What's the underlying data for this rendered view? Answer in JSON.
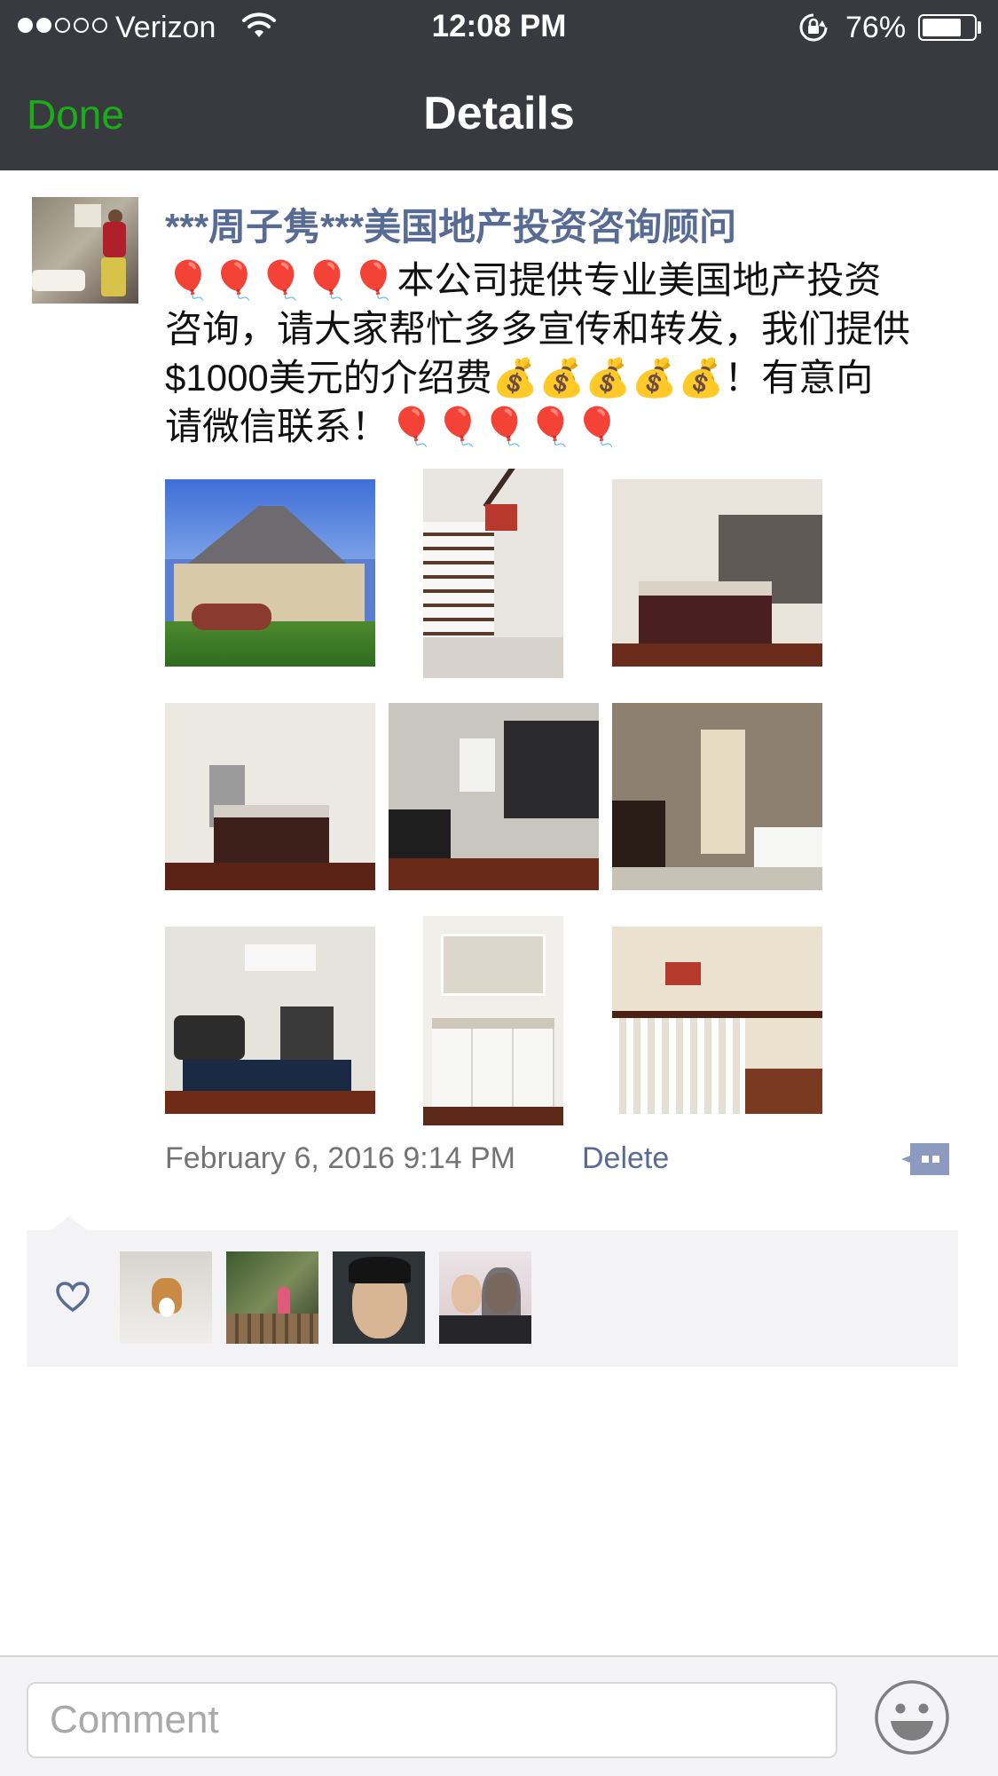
{
  "status_bar": {
    "carrier": "Verizon",
    "time": "12:08 PM",
    "battery_percent": "76%",
    "battery_level": 0.76,
    "signal_bars_filled": 2,
    "signal_bars_total": 5
  },
  "nav": {
    "done_label": "Done",
    "title": "Details"
  },
  "post": {
    "author": "***周子隽***美国地产投资咨询顾问",
    "text_line1": "🎈🎈🎈🎈🎈本公司提供专业美国地产投资",
    "text_line2": "咨询，请大家帮忙多多宣传和转发，我们提供",
    "text_line3": "$1000美元的介绍费💰💰💰💰💰！有意向",
    "text_line4": "请微信联系！🎈🎈🎈🎈🎈",
    "photo_count": 9,
    "date": "February 6, 2016 9:14 PM",
    "delete_label": "Delete"
  },
  "likes": {
    "count": 4
  },
  "comment_bar": {
    "placeholder": "Comment"
  },
  "colors": {
    "nav_bg": "#393a3f",
    "done_green": "#1aad19",
    "link_blue": "#576b95",
    "likes_bg": "#f3f3f5"
  },
  "icons": [
    "wifi-icon",
    "rotation-lock-icon",
    "battery-icon",
    "comment-bubble-icon",
    "heart-icon",
    "emoji-face-icon"
  ]
}
